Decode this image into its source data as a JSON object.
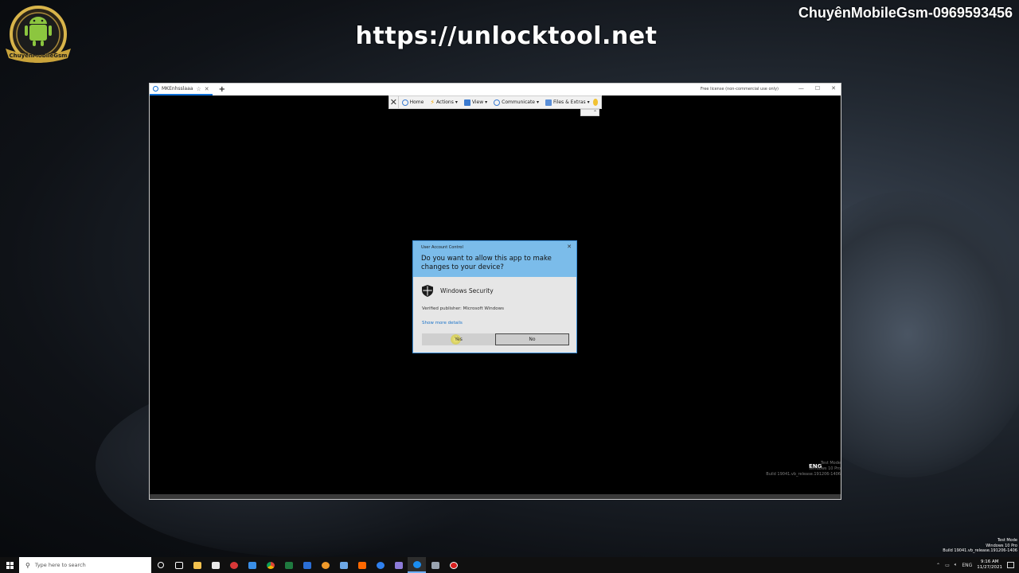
{
  "overlay": {
    "url_text": "https://unlocktool.net",
    "brand_text": "ChuyênMobileGsm-0969593456",
    "logo_text": "ChuyênMobileGsm"
  },
  "remote_viewer": {
    "tab_label": "MKEnhsslaaa",
    "license_text": "Free license (non-commercial use only)",
    "toolbar": {
      "home": "Home",
      "actions": "Actions",
      "view": "View",
      "communicate": "Communicate",
      "files": "Files & Extras"
    }
  },
  "remote_screen": {
    "lang": "ENG",
    "watermark_line1": "Test Mode",
    "watermark_line2": "Windows 10 Pro",
    "watermark_line3": "Build 19041.vb_release.191206-1406"
  },
  "uac": {
    "title": "User Account Control",
    "question": "Do you want to allow this app to make changes to your device?",
    "app_name": "Windows Security",
    "publisher": "Verified publisher: Microsoft Windows",
    "details_link": "Show more details",
    "yes_label": "Yes",
    "no_label": "No"
  },
  "taskbar": {
    "search_placeholder": "Type here to search",
    "time": "9:16 AM",
    "date": "11/27/2021",
    "lang": "ENG"
  },
  "system_watermark": {
    "line1": "Test Mode",
    "line2": "Windows 10 Pro",
    "line3": "Build 19041.vb_release.191206-1406"
  },
  "colors": {
    "uac_header": "#7bbcea",
    "link": "#1a73c9",
    "accent": "#0e6fd6"
  }
}
